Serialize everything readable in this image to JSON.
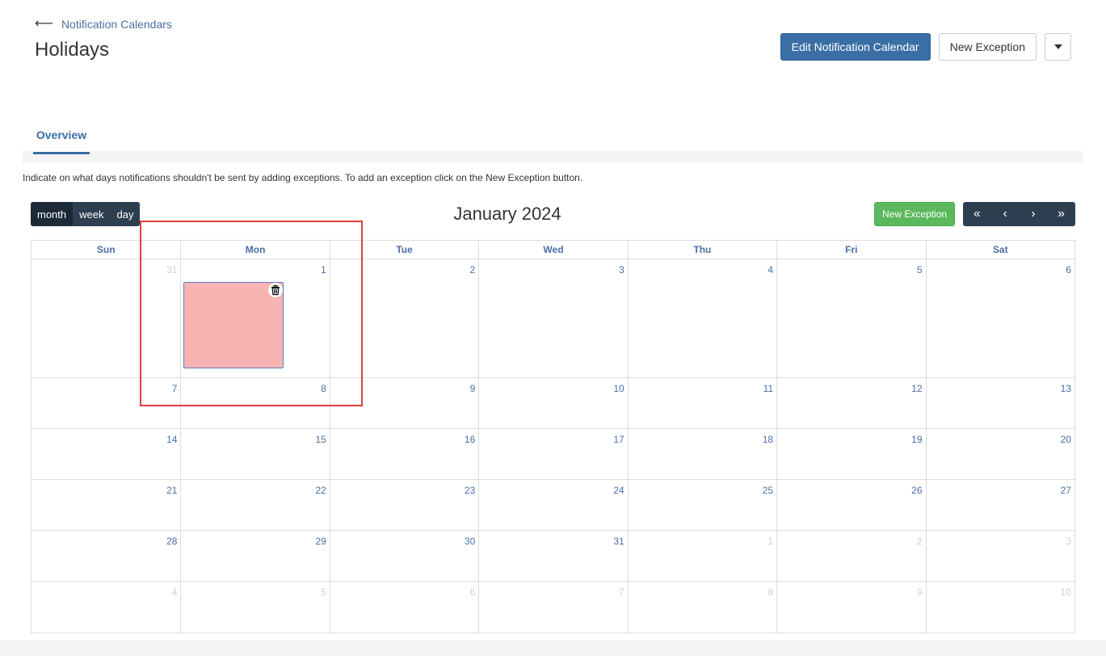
{
  "breadcrumb": {
    "back_label": "Notification Calendars"
  },
  "page": {
    "title": "Holidays"
  },
  "header_actions": {
    "edit_label": "Edit Notification Calendar",
    "new_exception_label": "New Exception"
  },
  "tabs": [
    {
      "label": "Overview",
      "active": true
    }
  ],
  "help_text": "Indicate on what days notifications shouldn't be sent by adding exceptions. To add an exception click on the New Exception button.",
  "calendar": {
    "views": [
      {
        "label": "month",
        "active": true
      },
      {
        "label": "week",
        "active": false
      },
      {
        "label": "day",
        "active": false
      }
    ],
    "title": "January 2024",
    "new_exception_label": "New Exception",
    "nav": [
      {
        "label": "«",
        "icon": "double-chevron-left-icon"
      },
      {
        "label": "‹",
        "icon": "chevron-left-icon"
      },
      {
        "label": "›",
        "icon": "chevron-right-icon"
      },
      {
        "label": "»",
        "icon": "double-chevron-right-icon"
      }
    ],
    "weekdays": [
      "Sun",
      "Mon",
      "Tue",
      "Wed",
      "Thu",
      "Fri",
      "Sat"
    ],
    "weeks": [
      [
        {
          "d": "31",
          "o": true
        },
        {
          "d": "1"
        },
        {
          "d": "2"
        },
        {
          "d": "3"
        },
        {
          "d": "4"
        },
        {
          "d": "5"
        },
        {
          "d": "6"
        }
      ],
      [
        {
          "d": "7"
        },
        {
          "d": "8"
        },
        {
          "d": "9"
        },
        {
          "d": "10"
        },
        {
          "d": "11"
        },
        {
          "d": "12"
        },
        {
          "d": "13"
        }
      ],
      [
        {
          "d": "14"
        },
        {
          "d": "15"
        },
        {
          "d": "16"
        },
        {
          "d": "17"
        },
        {
          "d": "18"
        },
        {
          "d": "19"
        },
        {
          "d": "20"
        }
      ],
      [
        {
          "d": "21"
        },
        {
          "d": "22"
        },
        {
          "d": "23"
        },
        {
          "d": "24"
        },
        {
          "d": "25"
        },
        {
          "d": "26"
        },
        {
          "d": "27"
        }
      ],
      [
        {
          "d": "28"
        },
        {
          "d": "29"
        },
        {
          "d": "30"
        },
        {
          "d": "31"
        },
        {
          "d": "1",
          "o": true
        },
        {
          "d": "2",
          "o": true
        },
        {
          "d": "3",
          "o": true
        }
      ],
      [
        {
          "d": "4",
          "o": true
        },
        {
          "d": "5",
          "o": true
        },
        {
          "d": "6",
          "o": true
        },
        {
          "d": "7",
          "o": true
        },
        {
          "d": "8",
          "o": true
        },
        {
          "d": "9",
          "o": true
        },
        {
          "d": "10",
          "o": true
        }
      ]
    ],
    "exception_event": {
      "week": 0,
      "day": 1,
      "color": "#f8b3b3",
      "icon": "trash-icon"
    }
  },
  "colors": {
    "primary": "#3a6ea5",
    "success": "#5cb85c",
    "toolbar_dark": "#2c3e50",
    "highlight": "#e04040"
  }
}
